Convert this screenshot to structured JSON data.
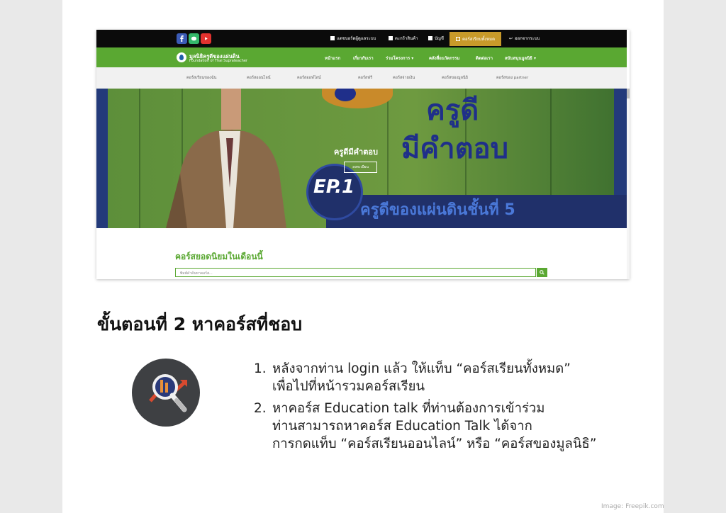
{
  "screenshot": {
    "topbar": {
      "links": [
        {
          "label": "แดชบอร์ดผู้ดูแลระบบ"
        },
        {
          "label": "ตะกร้าสินค้า"
        },
        {
          "label": "บัญชี"
        },
        {
          "label": "คอร์สเรียนทั้งหมด"
        },
        {
          "label": "ออกจากระบบ"
        }
      ]
    },
    "header": {
      "logo_th": "มูลนิธิครูดีของแผ่นดิน",
      "logo_en": "Foundation of Thai Suprateacher",
      "nav": [
        "หน้าแรก",
        "เกี่ยวกับเรา",
        "ร่วมโครงการ",
        "คลังสื่อนวัตกรรม",
        "ติดต่อเรา",
        "สนับสนุนมูลนิธิ"
      ]
    },
    "subnav": [
      "คอร์สเรียนของฉัน",
      "คอร์สออนไลน์",
      "คอร์สออฟไลน์",
      "คอร์สฟรี",
      "คอร์สจ่ายเงิน",
      "คอร์สของมูลนิธิ",
      "คอร์สของ partner"
    ],
    "hero": {
      "big_line1": "ครูดี",
      "big_line2": "มีคำตอบ",
      "ep": "EP.1",
      "band": "ครูดีของแผ่นดินชั้นที่ 5",
      "overlay_title": "ครูดีมีคำตอบ",
      "overlay_button": "ลงทะเบียน"
    },
    "popular_title": "คอร์สยอดนิยมในเดือนนี้",
    "search_placeholder": "พิมพ์คำค้นหาคอร์ส..."
  },
  "heading": "ขั้นตอนที่ 2 หาคอร์สที่ชอบ",
  "steps": [
    {
      "num": "1.",
      "lines": [
        "หลังจากท่าน login แล้ว ให้แท็บ “คอร์สเรียนทั้งหมด”",
        "เพื่อไปที่หน้ารวมคอร์สเรียน"
      ]
    },
    {
      "num": "2.",
      "lines": [
        "หาคอร์ส Education talk ที่ท่านต้องการเข้าร่วม",
        "ท่านสามารถหาคอร์ส Education Talk ได้จาก",
        "การกดแท็บ “คอร์สเรียนออนไลน์” หรือ “คอร์สของมูลนิธิ”"
      ]
    }
  ],
  "credit": "Image: Freepik.com",
  "colors": {
    "green": "#5aa832",
    "gold": "#c89a2a",
    "navy": "#20306a"
  }
}
